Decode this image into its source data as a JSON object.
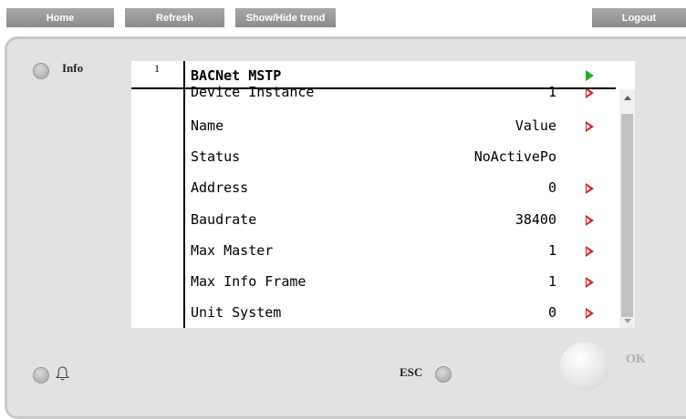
{
  "toolbar": {
    "home": "Home",
    "refresh": "Refresh",
    "trend": "Show/Hide trend",
    "logout": "Logout"
  },
  "panel": {
    "info_label": "Info",
    "esc_label": "ESC",
    "ok_label": "OK"
  },
  "screen": {
    "page_number": "1",
    "title": "BACNet MSTP",
    "rows": [
      {
        "label": "Device Instance",
        "value": "1",
        "arrow": true
      },
      {
        "label": "Name",
        "value": "Value",
        "arrow": true
      },
      {
        "label": "Status",
        "value": "NoActivePo",
        "arrow": false
      },
      {
        "label": "Address",
        "value": "0",
        "arrow": true
      },
      {
        "label": "Baudrate",
        "value": "38400",
        "arrow": true
      },
      {
        "label": "Max Master",
        "value": "1",
        "arrow": true
      },
      {
        "label": "Max Info Frame",
        "value": "1",
        "arrow": true
      },
      {
        "label": "Unit System",
        "value": "0",
        "arrow": true
      }
    ]
  },
  "icons": {
    "bell": "bell-icon",
    "title_arrow": "green-triangle-icon",
    "row_arrow": "red-triangle-icon"
  },
  "colors": {
    "toolbar_button": "#999999",
    "panel_bg": "#e2e2e2",
    "arrow_green": "#22aa22",
    "arrow_red": "#dd2222"
  }
}
